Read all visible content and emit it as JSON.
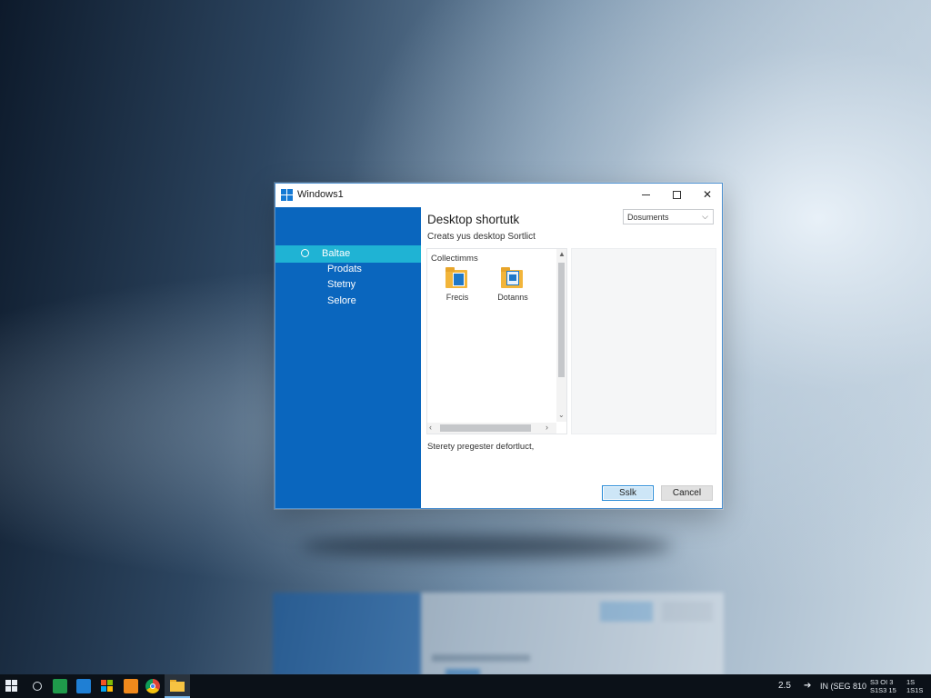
{
  "window": {
    "title": "Windows1",
    "minimize_label": "",
    "close_label": "✕"
  },
  "sidebar": {
    "items": [
      {
        "label": "Baltae",
        "active": true
      },
      {
        "label": "Prodats",
        "active": false
      },
      {
        "label": "Stetny",
        "active": false
      },
      {
        "label": "Selore",
        "active": false
      }
    ]
  },
  "content": {
    "heading": "Desktop shortutk",
    "subtitle": "Creats yus desktop Sortlict",
    "dropdown_value": "Dosuments",
    "pane_label": "Collectimms",
    "files": [
      {
        "label": "Frecis",
        "icon": "folder-icon"
      },
      {
        "label": "Dotanns",
        "icon": "folder-icon"
      }
    ],
    "status_text": "Sterety pregester defortluct,"
  },
  "buttons": {
    "save_label": "Sslk",
    "cancel_label": "Cancel"
  },
  "taskbar": {
    "icons": [
      "start-icon",
      "search-icon",
      "sheet-icon",
      "mail-icon",
      "store-icon",
      "office-icon",
      "browser-icon",
      "file-explorer-icon"
    ],
    "tray_number": "2.5",
    "tray_network": "IN (SEG 810",
    "tray_clock_top": "S3 OI 3",
    "tray_clock_bottom": "S1S3 15",
    "tray_right_top": "1S",
    "tray_right_bottom": "1S1S"
  },
  "colors": {
    "sidebar": "#0a66be",
    "sidebar_active": "#1fb3d4",
    "accent": "#1f87d6"
  }
}
